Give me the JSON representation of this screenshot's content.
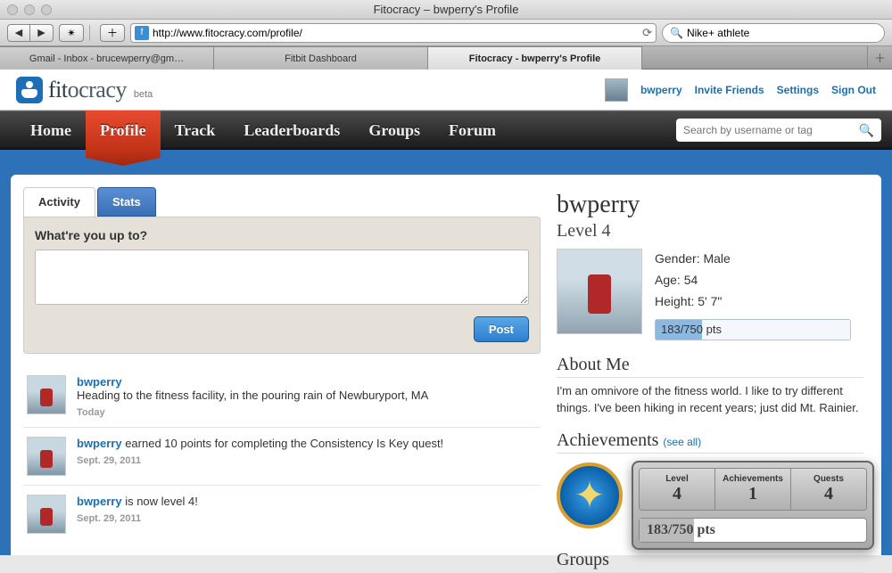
{
  "browser": {
    "title": "Fitocracy – bwperry's Profile",
    "url": "http://www.fitocracy.com/profile/",
    "search_value": "Nike+ athlete",
    "tabs": [
      {
        "label": "Gmail - Inbox - brucewperry@gm…"
      },
      {
        "label": "Fitbit Dashboard"
      },
      {
        "label": "Fitocracy - bwperry's Profile"
      }
    ],
    "active_tab_index": 2
  },
  "header": {
    "brand_a": "fit",
    "brand_b": "ocracy",
    "beta": "beta",
    "user": "bwperry",
    "links": {
      "invite": "Invite Friends",
      "settings": "Settings",
      "signout": "Sign Out"
    }
  },
  "nav": {
    "items": [
      "Home",
      "Profile",
      "Track",
      "Leaderboards",
      "Groups",
      "Forum"
    ],
    "active_index": 1,
    "search_placeholder": "Search by username or tag"
  },
  "profile_tabs": {
    "activity": "Activity",
    "stats": "Stats"
  },
  "post_box": {
    "prompt": "What're you up to?",
    "button": "Post"
  },
  "feed": [
    {
      "user": "bwperry",
      "text": "Heading to the fitness facility, in the pouring rain of Newburyport, MA",
      "is_status": true,
      "time": "Today"
    },
    {
      "user": "bwperry",
      "text": " earned 10 points for completing the Consistency Is Key quest!",
      "is_status": false,
      "time": "Sept. 29, 2011"
    },
    {
      "user": "bwperry",
      "text": " is now level 4!",
      "is_status": false,
      "time": "Sept. 29, 2011"
    }
  ],
  "profile": {
    "username": "bwperry",
    "level_label": "Level 4",
    "gender_label": "Gender: Male",
    "age_label": "Age: 54",
    "height_label": "Height: 5' 7\"",
    "points_text": "183/750 pts"
  },
  "about": {
    "heading": "About Me",
    "text": "I'm an omnivore of the fitness world. I like to try different things. I've been hiking in recent years; just did Mt. Rainier."
  },
  "achievements": {
    "heading": "Achievements",
    "see_all": "(see all)"
  },
  "groups": {
    "heading": "Groups"
  },
  "popup": {
    "stats": [
      {
        "label": "Level",
        "value": "4"
      },
      {
        "label": "Achievements",
        "value": "1"
      },
      {
        "label": "Quests",
        "value": "4"
      }
    ],
    "points_text": "183/750 pts"
  }
}
